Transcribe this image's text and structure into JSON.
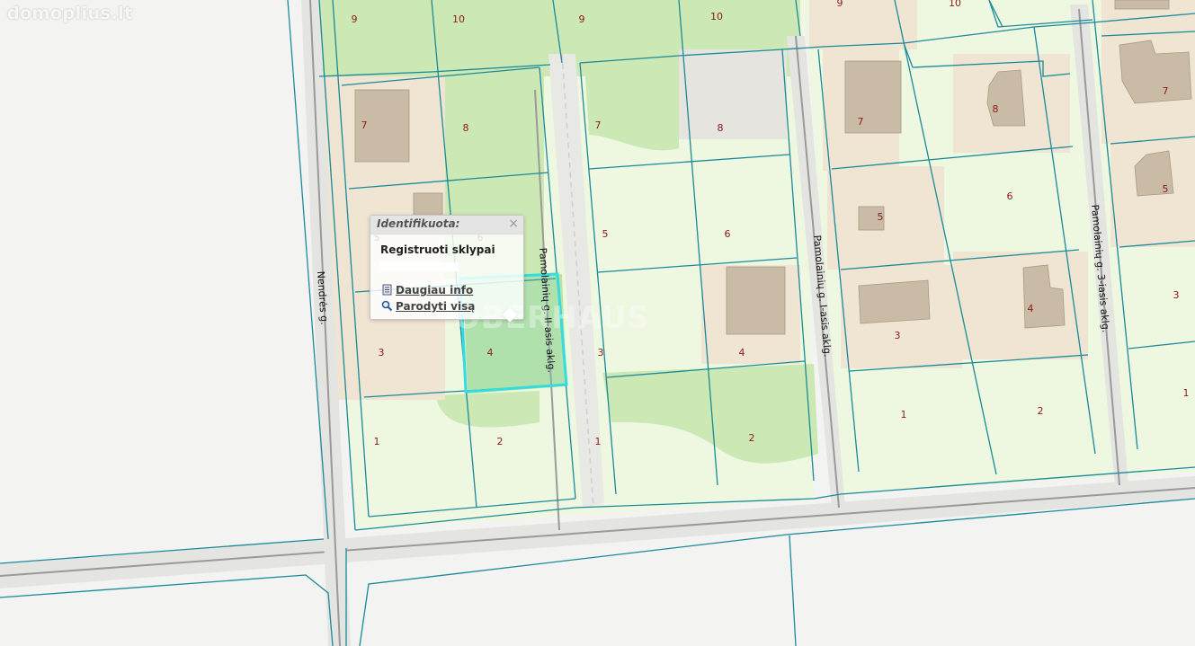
{
  "watermark": "domoplius.lt",
  "watermark_center": "OBERHAUS",
  "streets": {
    "nendres": "Nendrės g.",
    "aklig_2": "Pamolainių g. II-asis aklg.",
    "aklig_1": "Pamolainių g. I-asis aklg.",
    "aklig_3": "Pamolainių g. 3-iasis aklg."
  },
  "plots": {
    "p9a": "9",
    "p10a": "10",
    "p9b": "9",
    "p10b": "10",
    "p9c": "9",
    "p10c": "10",
    "p7a": "7",
    "p8a": "8",
    "p7b": "7",
    "p8b": "8",
    "p7c": "7",
    "p8c": "8",
    "p7d": "7",
    "p5a": "5",
    "p6a": "6",
    "p5b": "5",
    "p6b": "6",
    "p5c": "5",
    "p6c": "6",
    "p5d": "5",
    "p3a": "3",
    "p4a": "4",
    "p3b": "3",
    "p4b": "4",
    "p3c": "3",
    "p4c": "4",
    "p3d": "3",
    "p1a": "1",
    "p2a": "2",
    "p1b": "1",
    "p2b": "2",
    "p1c": "1",
    "p2c": "2",
    "p1d": "1"
  },
  "popup": {
    "title": "Identifikuota:",
    "layer": "Registruoti sklypai",
    "more_info": "Daugiau info",
    "show_all": "Parodyti visą",
    "close": "×"
  },
  "colors": {
    "parcel_line": "#1a8a9a",
    "selected": "#33dddd",
    "plot_number": "#8b1a1a",
    "lawn": "#eef7e0",
    "green": "#cce8b4",
    "built": "#efe5d2",
    "building": "#c9bba5"
  }
}
